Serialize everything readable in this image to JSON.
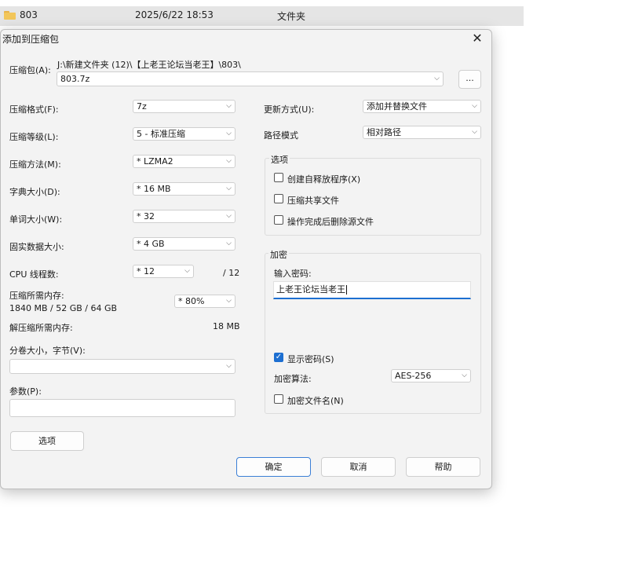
{
  "explorer": {
    "name": "803",
    "date": "2025/6/22 18:53",
    "type": "文件夹"
  },
  "dialog": {
    "title": "添加到压缩包",
    "close_glyph": "✕",
    "archive_label": "压缩包(A):",
    "archive_path": "J:\\新建文件夹 (12)\\【上老王论坛当老王】\\803\\",
    "archive_name": "803.7z",
    "browse_label": "...",
    "format_label": "压缩格式(F):",
    "format_value": "7z",
    "level_label": "压缩等级(L):",
    "level_value": "5 - 标准压缩",
    "method_label": "压缩方法(M):",
    "method_value": "* LZMA2",
    "dict_label": "字典大小(D):",
    "dict_value": "* 16 MB",
    "word_label": "单词大小(W):",
    "word_value": "* 32",
    "solid_label": "固实数据大小:",
    "solid_value": "* 4 GB",
    "cpu_label": "CPU 线程数:",
    "cpu_value": "* 12",
    "cpu_total": "/ 12",
    "mem_comp_label": "压缩所需内存:",
    "mem_comp_detail": "1840 MB / 52 GB / 64 GB",
    "mem_comp_value": "* 80%",
    "mem_decomp_label": "解压缩所需内存:",
    "mem_decomp_value": "18 MB",
    "split_label": "分卷大小，字节(V):",
    "split_value": "",
    "params_label": "参数(P):",
    "params_value": "",
    "options_button": "选项",
    "update_label": "更新方式(U):",
    "update_value": "添加并替换文件",
    "path_label": "路径模式",
    "path_value": "相对路径",
    "options_group": "选项",
    "opt_sfx": "创建自释放程序(X)",
    "opt_shared": "压缩共享文件",
    "opt_delete": "操作完成后删除源文件",
    "encrypt_group": "加密",
    "pwd_label": "输入密码:",
    "pwd_value": "上老王论坛当老王",
    "show_pwd": "显示密码(S)",
    "enc_method_label": "加密算法:",
    "enc_method_value": "AES-256",
    "enc_names": "加密文件名(N)",
    "ok": "确定",
    "cancel": "取消",
    "help": "帮助"
  },
  "colors": {
    "accent": "#1d6fd1",
    "dialog_bg": "#f3f3f3",
    "explorer_row": "#e5e5e5"
  },
  "states": {
    "show_password": true,
    "sfx": false,
    "shared": false,
    "delete_after": false,
    "encrypt_names": false
  }
}
